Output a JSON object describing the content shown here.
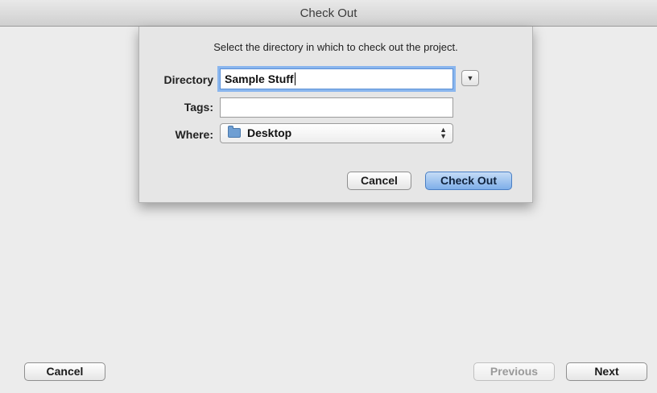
{
  "window": {
    "title": "Check Out"
  },
  "sheet": {
    "prompt": "Select the directory in which to check out the project.",
    "directory": {
      "label": "Directory",
      "value": "Sample Stuff"
    },
    "tags": {
      "label": "Tags:",
      "value": ""
    },
    "where": {
      "label": "Where:",
      "value": "Desktop",
      "icon": "folder-icon"
    },
    "buttons": {
      "cancel": "Cancel",
      "check_out": "Check Out"
    }
  },
  "footer": {
    "cancel": "Cancel",
    "previous": "Previous",
    "next": "Next"
  },
  "colors": {
    "default_button": "#7eaee9",
    "focus_ring": "#8ab6ee"
  }
}
